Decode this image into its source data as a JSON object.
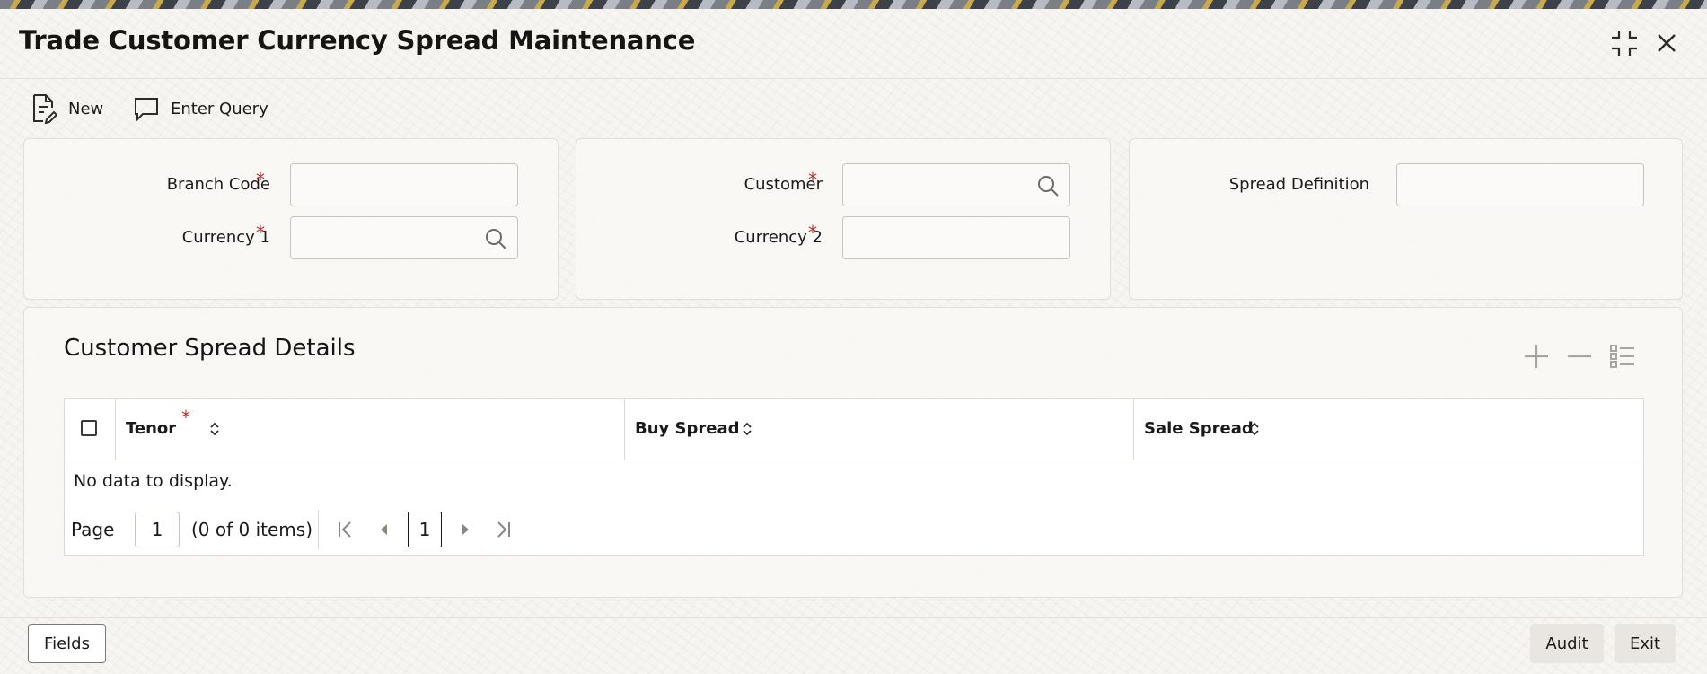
{
  "window": {
    "title": "Trade Customer Currency Spread Maintenance",
    "icons": [
      "collapse-icon",
      "close-icon"
    ]
  },
  "toolbar": {
    "new_label": "New",
    "enter_query_label": "Enter Query"
  },
  "form": {
    "branch_code": {
      "label": "Branch Code",
      "required": "*",
      "value": ""
    },
    "currency1": {
      "label": "Currency 1",
      "required": "*",
      "value": ""
    },
    "customer": {
      "label": "Customer",
      "required": "*",
      "value": ""
    },
    "currency2": {
      "label": "Currency 2",
      "required": "*",
      "value": ""
    },
    "spread_definition": {
      "label": "Spread Definition",
      "value": ""
    }
  },
  "details": {
    "title": "Customer Spread Details",
    "actions": [
      "add-icon",
      "remove-icon",
      "list-icon"
    ],
    "columns": [
      {
        "label": "Tenor",
        "required": "*"
      },
      {
        "label": "Buy Spread"
      },
      {
        "label": "Sale Spread"
      }
    ],
    "empty_message": "No data to display.",
    "pager": {
      "page_label": "Page",
      "page_value": "1",
      "summary": "(0 of 0 items)",
      "current_page": "1"
    }
  },
  "footer": {
    "fields_label": "Fields",
    "audit_label": "Audit",
    "exit_label": "Exit"
  },
  "colors": {
    "required": "#b8312f",
    "title_text": "#161513"
  }
}
